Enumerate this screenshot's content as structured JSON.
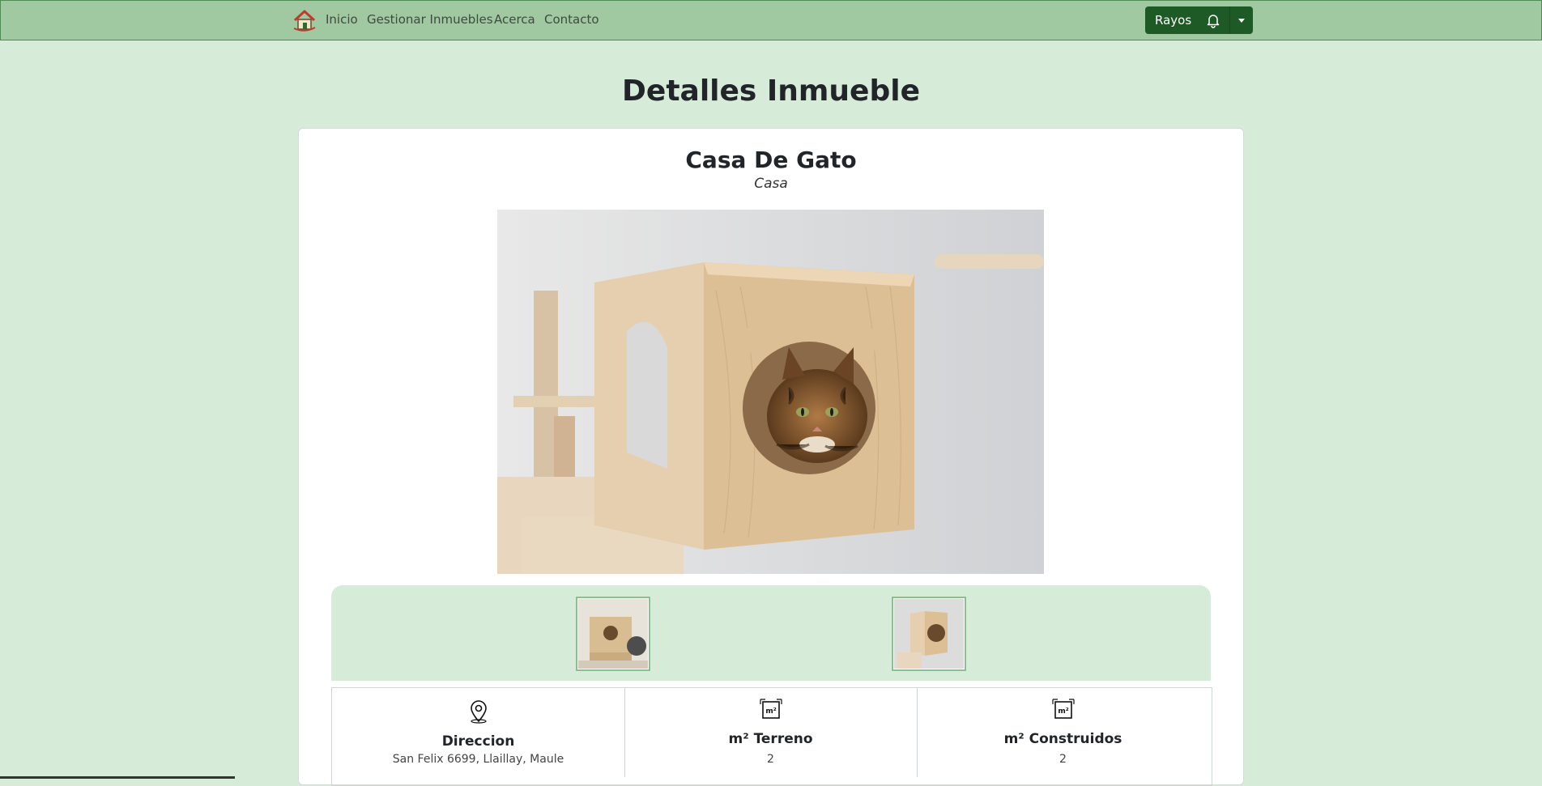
{
  "nav": {
    "links": [
      "Inicio",
      "Gestionar Inmuebles",
      "Acerca",
      "Contacto"
    ],
    "user_name": "Rayos"
  },
  "page": {
    "heading": "Detalles Inmueble"
  },
  "property": {
    "title": "Casa De Gato",
    "type": "Casa",
    "info": [
      {
        "icon": "location-pin-icon",
        "label": "Direccion",
        "value": "San Felix 6699, Llaillay, Maule"
      },
      {
        "icon": "area-m2-icon",
        "label": "m² Terreno",
        "value": "2"
      },
      {
        "icon": "area-m2-icon",
        "label": "m² Construidos",
        "value": "2"
      }
    ]
  },
  "colors": {
    "nav_bg": "#a0c9a1",
    "page_bg": "#d6ecd8",
    "user_button": "#1e5a26",
    "thumb_border": "#8cbf8f"
  }
}
